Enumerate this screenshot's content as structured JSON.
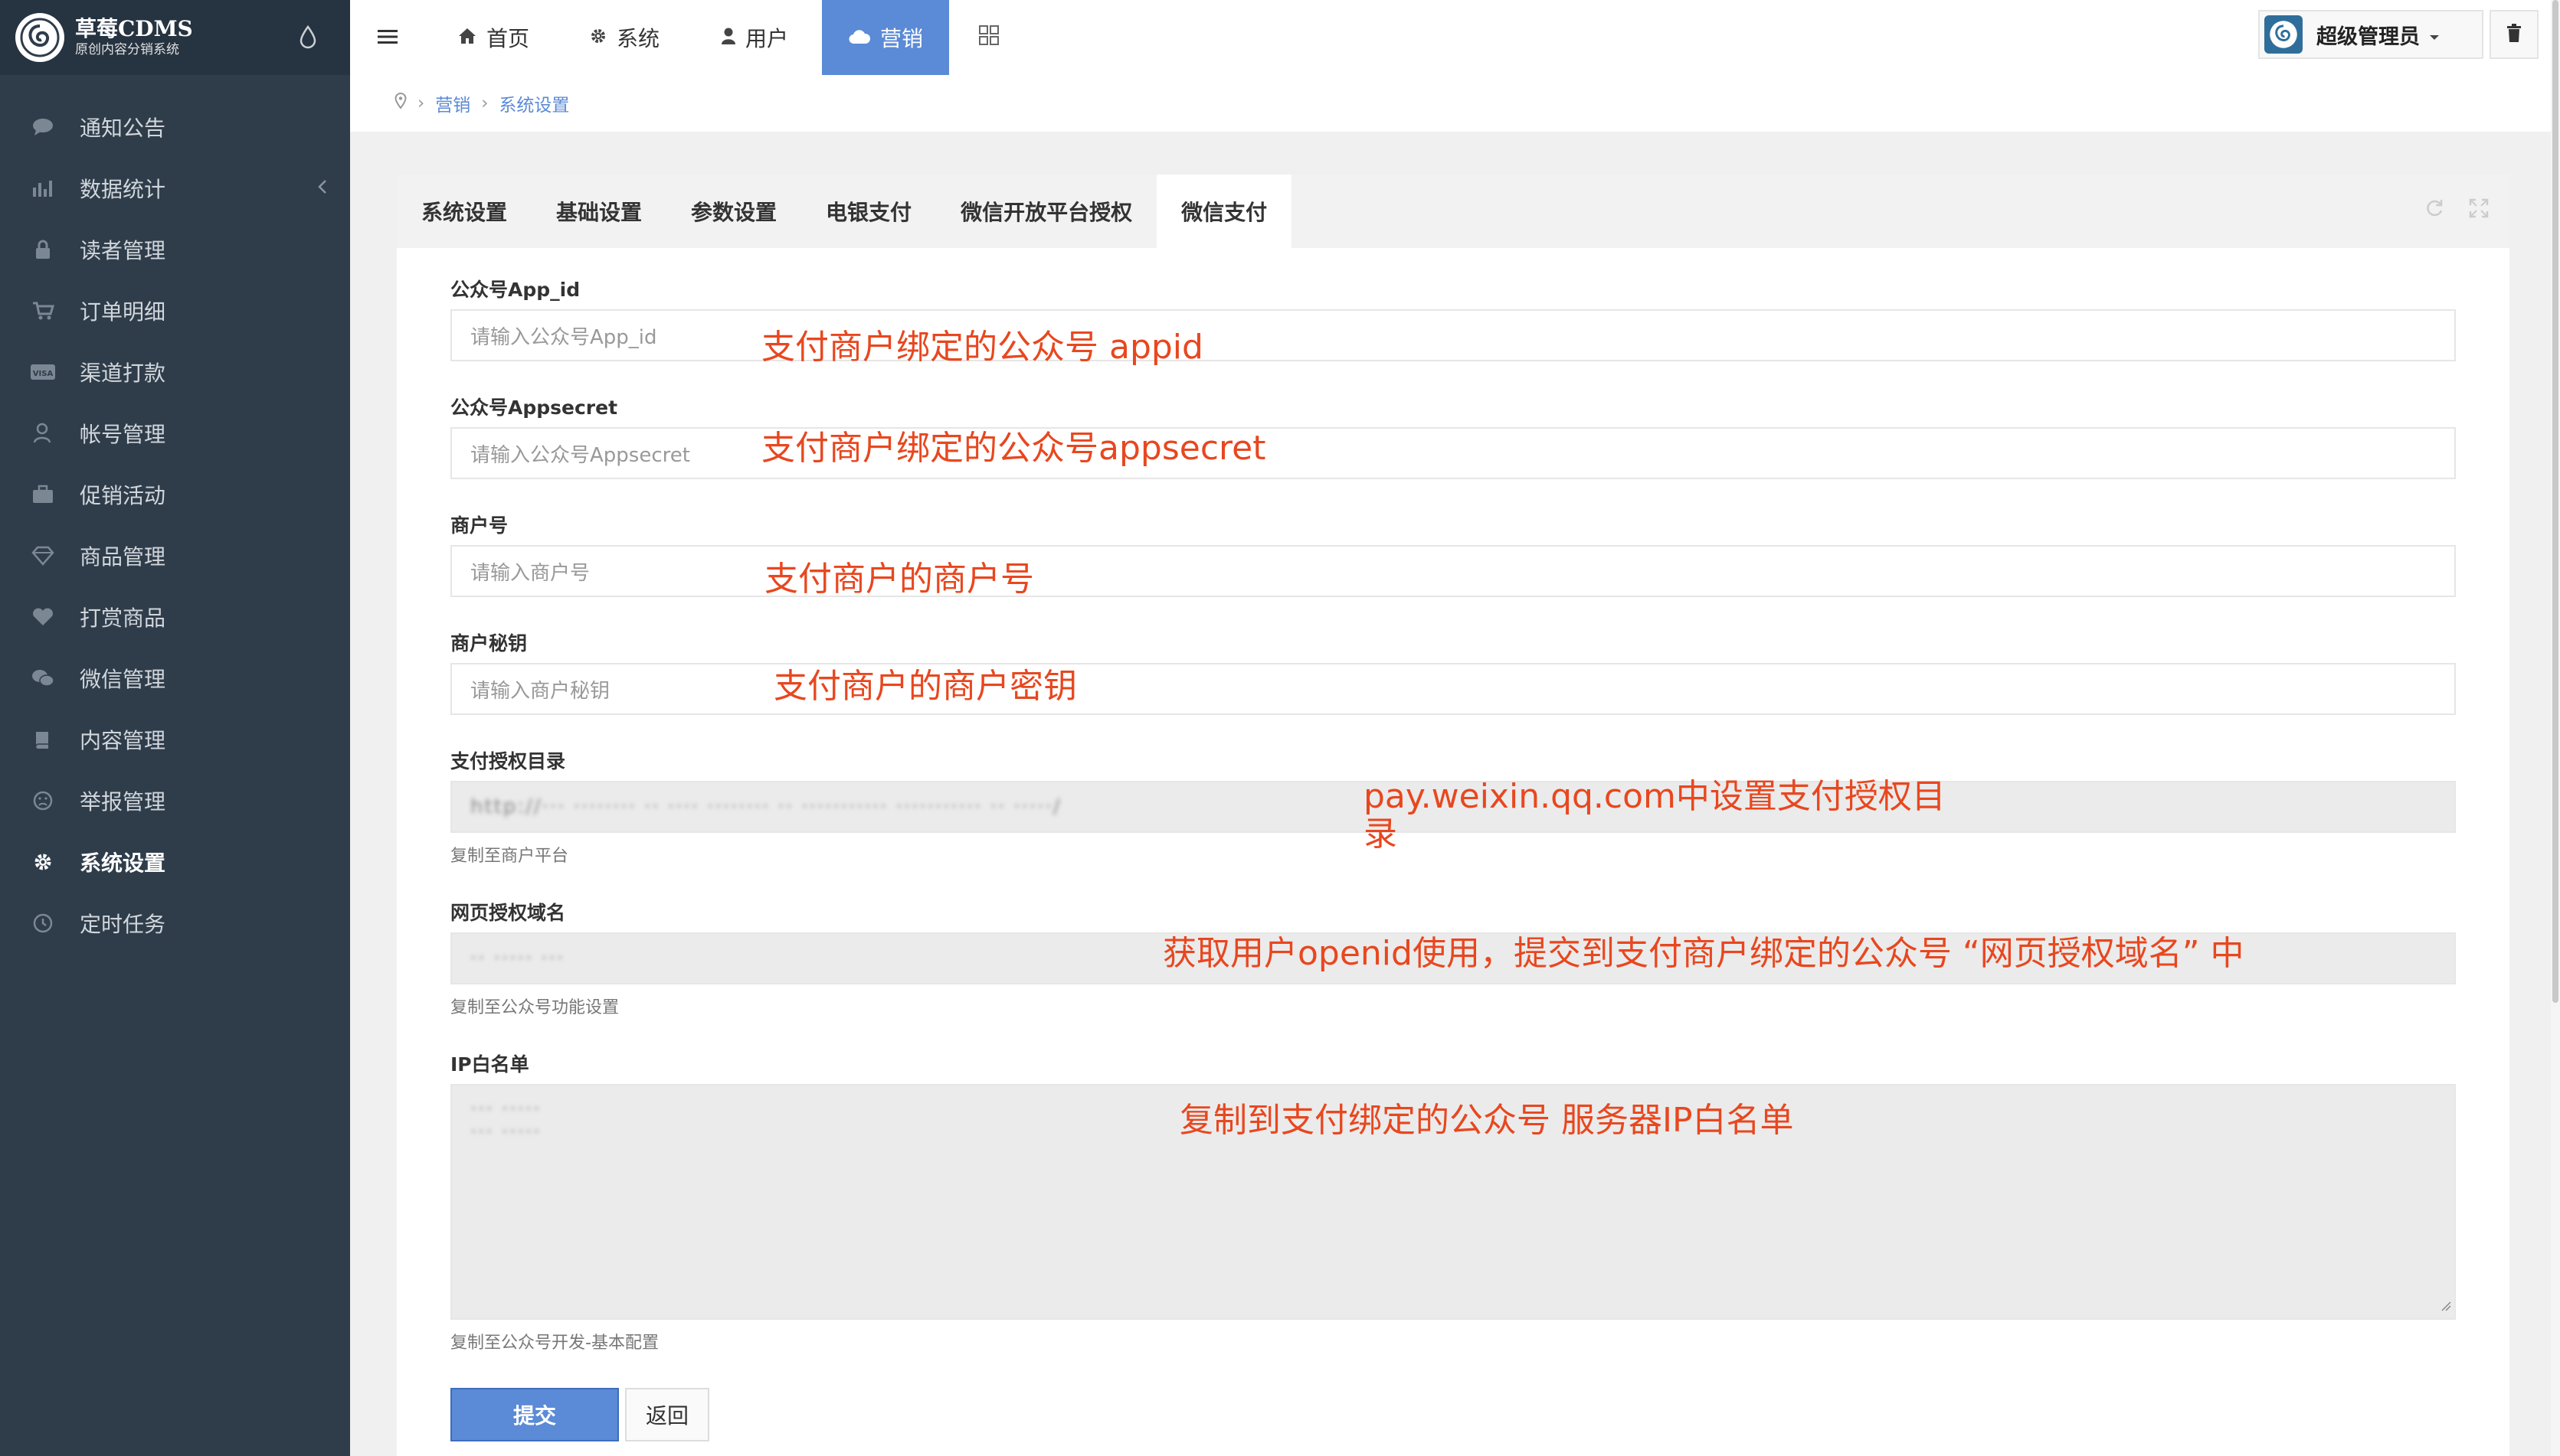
{
  "app": {
    "logo_title": "草莓CDMS",
    "logo_subtitle": "原创内容分销系统"
  },
  "sidebar": {
    "items": [
      {
        "label": "通知公告",
        "icon": "chat-bubble-icon"
      },
      {
        "label": "数据统计",
        "icon": "bar-chart-icon"
      },
      {
        "label": "读者管理",
        "icon": "lock-icon"
      },
      {
        "label": "订单明细",
        "icon": "cart-icon"
      },
      {
        "label": "渠道打款",
        "icon": "visa-card-icon"
      },
      {
        "label": "帐号管理",
        "icon": "user-icon"
      },
      {
        "label": "促销活动",
        "icon": "briefcase-icon"
      },
      {
        "label": "商品管理",
        "icon": "diamond-icon"
      },
      {
        "label": "打赏商品",
        "icon": "heart-icon"
      },
      {
        "label": "微信管理",
        "icon": "wechat-icon"
      },
      {
        "label": "内容管理",
        "icon": "book-icon"
      },
      {
        "label": "举报管理",
        "icon": "frown-icon"
      },
      {
        "label": "系统设置",
        "icon": "gear-icon",
        "active": true
      },
      {
        "label": "定时任务",
        "icon": "clock-icon"
      }
    ]
  },
  "topbar": {
    "nav": [
      {
        "label": "首页",
        "icon": "home-icon"
      },
      {
        "label": "系统",
        "icon": "gear-icon"
      },
      {
        "label": "用户",
        "icon": "user-icon"
      },
      {
        "label": "营销",
        "icon": "cloud-icon",
        "active": true
      }
    ],
    "admin_label": "超级管理员"
  },
  "breadcrumb": {
    "items": [
      "营销",
      "系统设置"
    ]
  },
  "tabs": [
    "系统设置",
    "基础设置",
    "参数设置",
    "电银支付",
    "微信开放平台授权",
    "微信支付"
  ],
  "active_tab": "微信支付",
  "form": {
    "app_id": {
      "label": "公众号App_id",
      "placeholder": "请输入公众号App_id"
    },
    "appsecret": {
      "label": "公众号Appsecret",
      "placeholder": "请输入公众号Appsecret"
    },
    "merchant_no": {
      "label": "商户号",
      "placeholder": "请输入商户号"
    },
    "merchant_key": {
      "label": "商户秘钥",
      "placeholder": "请输入商户秘钥"
    },
    "pay_dir": {
      "label": "支付授权目录",
      "value": "http://··· ········ ·· ···· ········ ·· ··········· ··········· ·· ·····/",
      "help": "复制至商户平台"
    },
    "auth_domain": {
      "label": "网页授权域名",
      "value": "·· ····· ···",
      "help": "复制至公众号功能设置"
    },
    "ip_whitelist": {
      "label": "IP白名单",
      "lines": [
        "··· ·····",
        "··· ·····"
      ],
      "help": "复制至公众号开发-基本配置"
    }
  },
  "buttons": {
    "submit": "提交",
    "back": "返回"
  },
  "annotations": {
    "app_id": "支付商户绑定的公众号 appid",
    "appsecret": "支付商户绑定的公众号appsecret",
    "merchant_no": "支付商户的商户号",
    "merchant_key": "支付商户的商户密钥",
    "pay_dir_1": "pay.weixin.qq.com中设置支付授权目",
    "pay_dir_2": "录",
    "auth_domain": "获取用户openid使用，提交到支付商户绑定的公众号 “网页授权域名” 中",
    "ip_whitelist": "复制到支付绑定的公众号 服务器IP白名单"
  },
  "colors": {
    "sidebar_bg": "#2f3d4b",
    "accent": "#5b8ad6",
    "annotation": "#e8471f"
  }
}
